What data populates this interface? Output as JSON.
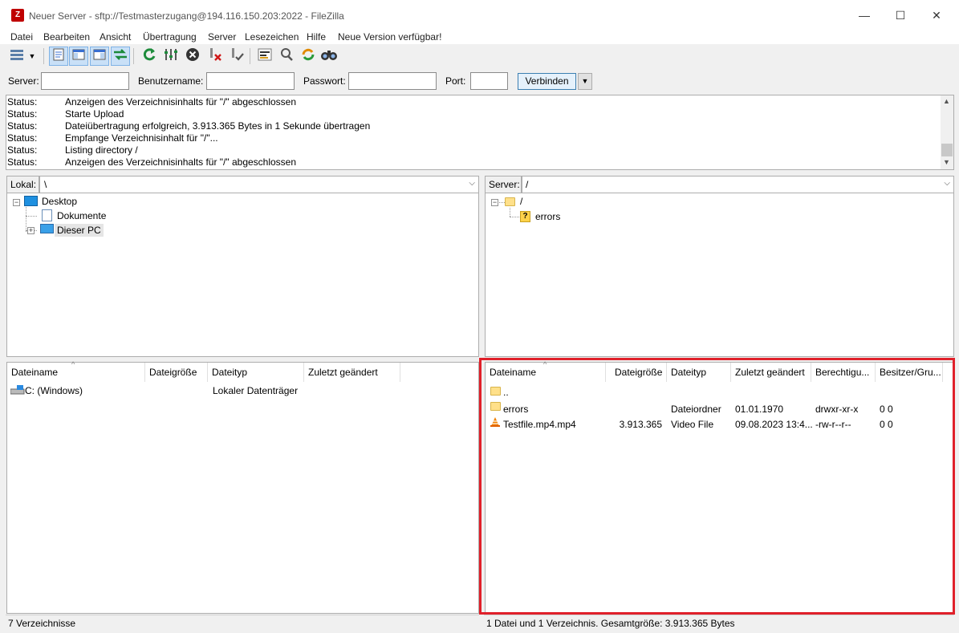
{
  "window": {
    "title": "Neuer Server - sftp://Testmasterzugang@194.116.150.203:2022 - FileZilla",
    "app_icon": "Z",
    "minimize": "—",
    "maximize": "☐",
    "close": "✕"
  },
  "menu": [
    "Datei",
    "Bearbeiten",
    "Ansicht",
    "Übertragung",
    "Server",
    "Lesezeichen",
    "Hilfe",
    "Neue Version verfügbar!"
  ],
  "toolbar": {
    "icons": [
      "site-manager-icon",
      "dropdown-arrow-icon",
      "toggle-log-icon",
      "toggle-local-tree-icon",
      "toggle-remote-tree-icon",
      "toggle-queue-icon",
      "refresh-icon",
      "process-queue-icon",
      "cancel-icon",
      "disconnect-icon",
      "reconnect-icon",
      "filter-icon",
      "compare-icon",
      "sync-browse-icon",
      "search-icon"
    ]
  },
  "quickconnect": {
    "server_label": "Server:",
    "user_label": "Benutzername:",
    "pass_label": "Passwort:",
    "port_label": "Port:",
    "connect_label": "Verbinden",
    "server_value": "",
    "user_value": "",
    "pass_value": "",
    "port_value": ""
  },
  "log": [
    {
      "status": "Status:",
      "msg": "Anzeigen des Verzeichnisinhalts für \"/\" abgeschlossen"
    },
    {
      "status": "Status:",
      "msg": "Starte Upload"
    },
    {
      "status": "Status:",
      "msg": "Dateiübertragung erfolgreich, 3.913.365 Bytes in 1 Sekunde übertragen"
    },
    {
      "status": "Status:",
      "msg": "Empfange Verzeichnisinhalt für \"/\"..."
    },
    {
      "status": "Status:",
      "msg": "Listing directory /"
    },
    {
      "status": "Status:",
      "msg": "Anzeigen des Verzeichnisinhalts für \"/\" abgeschlossen"
    }
  ],
  "local": {
    "path_label": "Lokal:",
    "path": "\\",
    "tree": [
      "Desktop",
      "Dokumente",
      "Dieser PC"
    ],
    "columns": [
      "Dateiname",
      "Dateigröße",
      "Dateityp",
      "Zuletzt geändert"
    ],
    "rows": [
      {
        "name": "C: (Windows)",
        "size": "",
        "type": "Lokaler Datenträger",
        "modified": ""
      }
    ],
    "status": "7 Verzeichnisse"
  },
  "remote": {
    "path_label": "Server:",
    "path": "/",
    "tree": [
      "/",
      "errors"
    ],
    "columns": [
      "Dateiname",
      "Dateigröße",
      "Dateityp",
      "Zuletzt geändert",
      "Berechtigu...",
      "Besitzer/Gru..."
    ],
    "rows": [
      {
        "name": "..",
        "size": "",
        "type": "",
        "modified": "",
        "perm": "",
        "owner": ""
      },
      {
        "name": "errors",
        "size": "",
        "type": "Dateiordner",
        "modified": "01.01.1970",
        "perm": "drwxr-xr-x",
        "owner": "0 0"
      },
      {
        "name": "Testfile.mp4.mp4",
        "size": "3.913.365",
        "type": "Video File",
        "modified": "09.08.2023 13:4...",
        "perm": "-rw-r--r--",
        "owner": "0 0"
      }
    ],
    "status": "1 Datei und 1 Verzeichnis. Gesamtgröße: 3.913.365 Bytes"
  },
  "colors": {
    "highlight": "#e0202a",
    "accent": "#3c7fb1"
  }
}
